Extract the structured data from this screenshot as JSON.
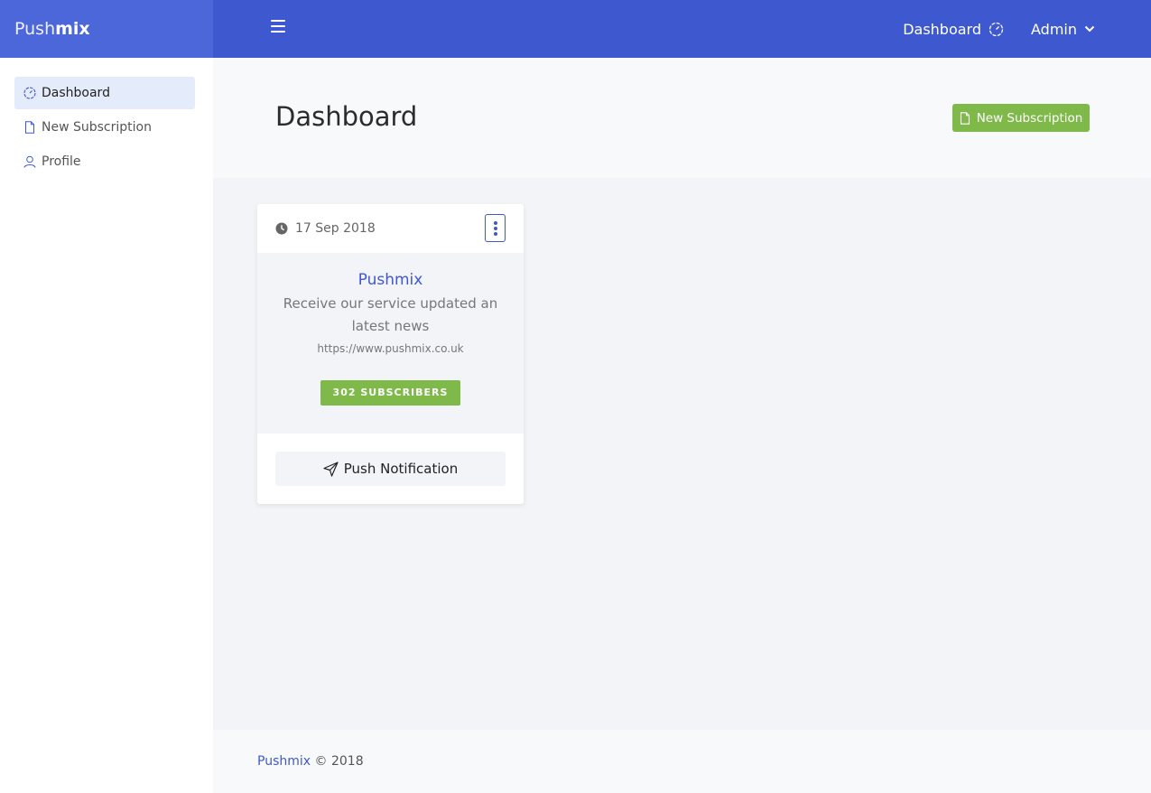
{
  "brand": {
    "part1": "Push",
    "part2": "mix"
  },
  "header": {
    "dashboard_link": "Dashboard",
    "user_menu": "Admin"
  },
  "sidebar": {
    "items": [
      {
        "label": "Dashboard",
        "icon": "gauge-icon",
        "active": true
      },
      {
        "label": "New Subscription",
        "icon": "file-icon",
        "active": false
      },
      {
        "label": "Profile",
        "icon": "user-icon",
        "active": false
      }
    ]
  },
  "page": {
    "title": "Dashboard",
    "new_button": "New Subscription"
  },
  "card": {
    "date": "17 Sep 2018",
    "name": "Pushmix",
    "description": "Receive our service updated an latest news",
    "url": "https://www.pushmix.co.uk",
    "subscribers": "302 SUBSCRIBERS",
    "push_button": "Push Notification"
  },
  "footer": {
    "brand": "Pushmix",
    "copyright": "© 2018"
  },
  "colors": {
    "primary": "#3e58cf",
    "brand_bg": "#4b67d9",
    "success": "#7fb94a",
    "active_item": "#e4ecfc"
  }
}
